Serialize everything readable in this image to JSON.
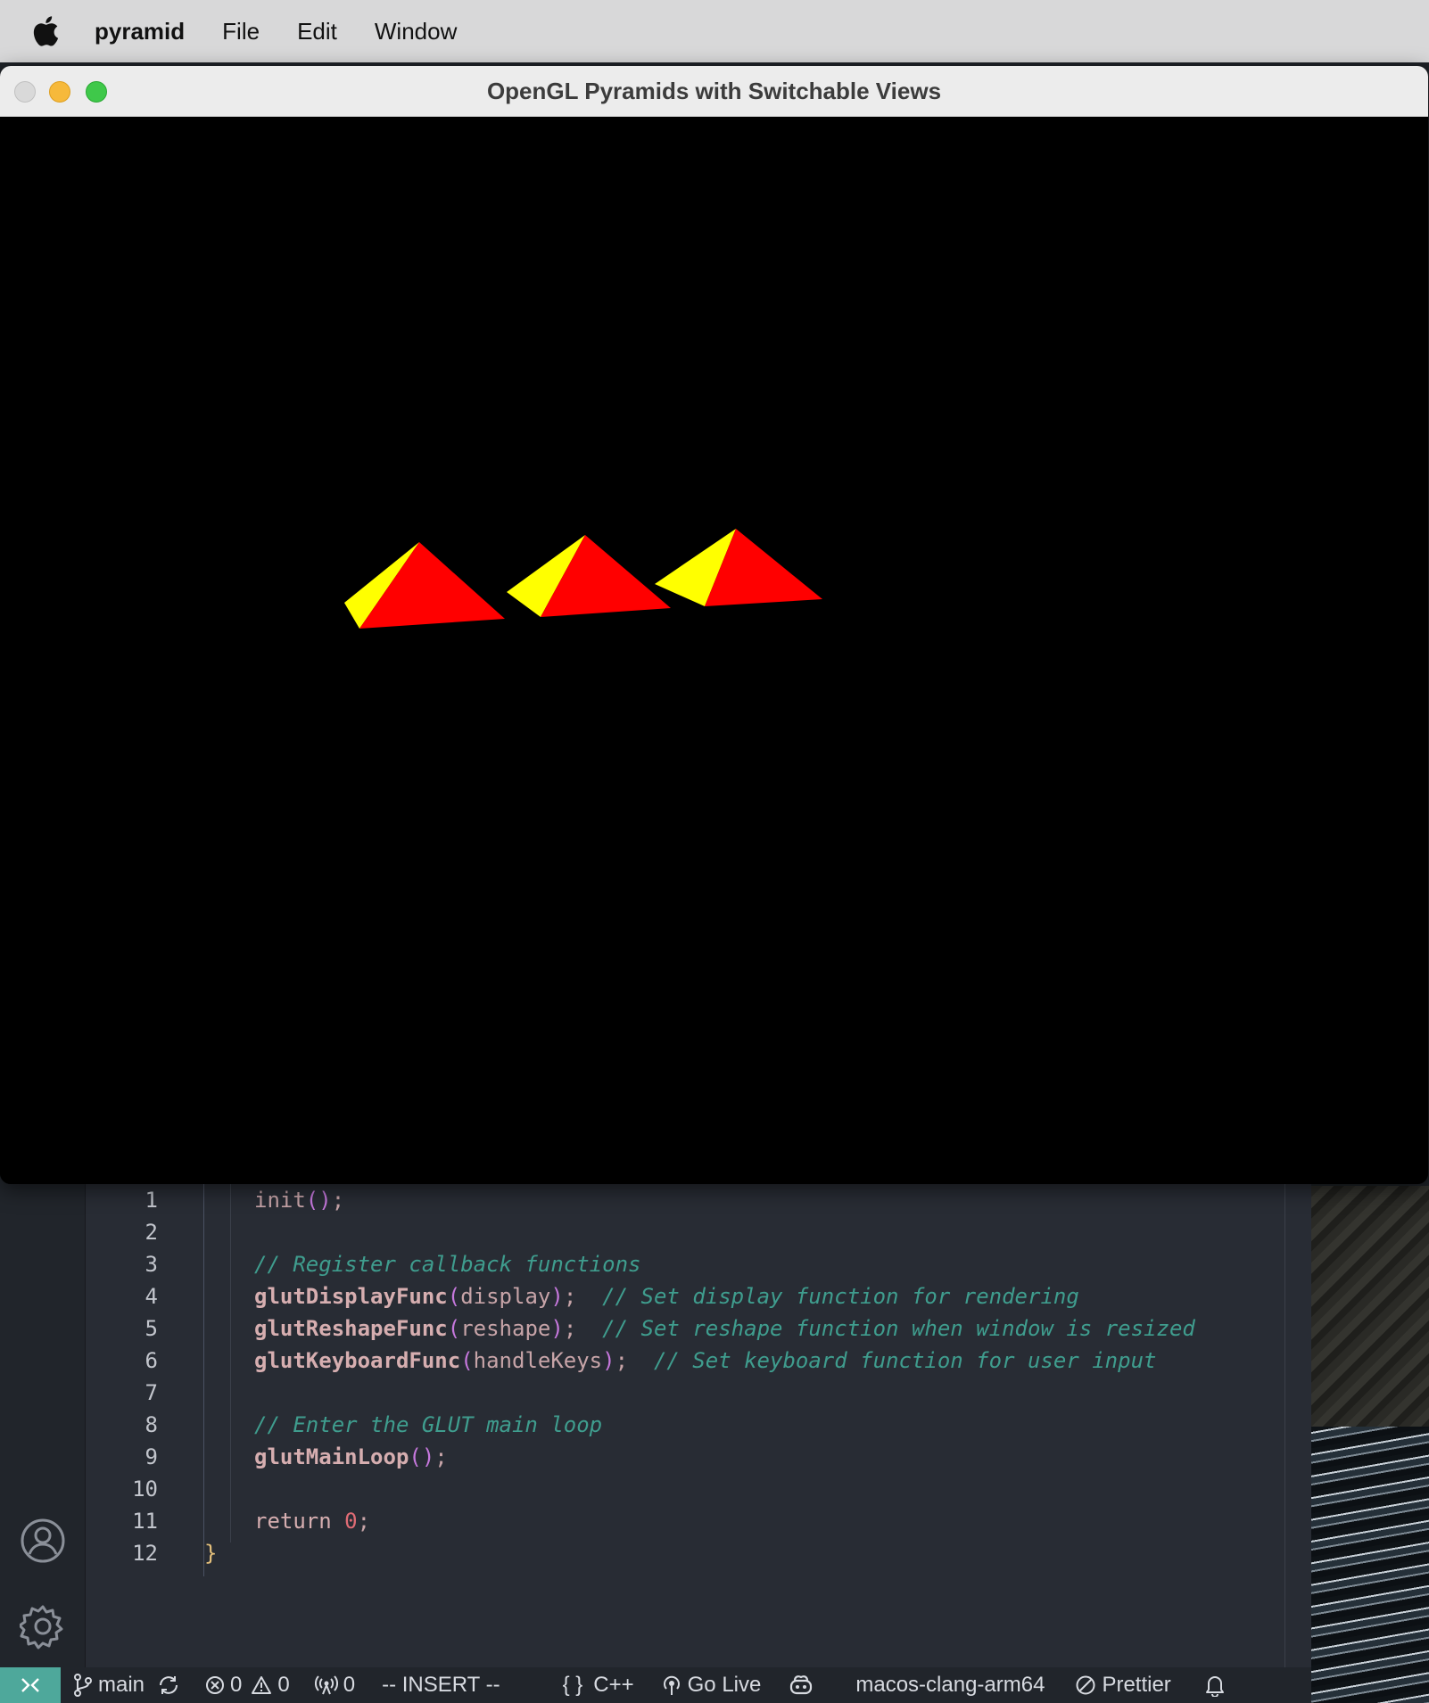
{
  "menubar": {
    "app_name": "pyramid",
    "items": [
      "File",
      "Edit",
      "Window"
    ]
  },
  "gl_window": {
    "title": "OpenGL Pyramids with Switchable Views",
    "colors": {
      "face_front": "#ff0000",
      "face_side": "#ffff00",
      "background": "#000000"
    },
    "pyramid_count": 3
  },
  "editor": {
    "lines": [
      {
        "n": "1",
        "tokens": [
          [
            "plain",
            "init"
          ],
          [
            "paren",
            "()"
          ],
          [
            "punct",
            ";"
          ]
        ]
      },
      {
        "n": "2",
        "tokens": []
      },
      {
        "n": "3",
        "tokens": [
          [
            "comment",
            "// Register callback functions"
          ]
        ]
      },
      {
        "n": "4",
        "tokens": [
          [
            "fn",
            "glutDisplayFunc"
          ],
          [
            "paren",
            "("
          ],
          [
            "plain",
            "display"
          ],
          [
            "paren",
            ")"
          ],
          [
            "punct",
            ";  "
          ],
          [
            "comment",
            "// Set display function for rendering"
          ]
        ]
      },
      {
        "n": "5",
        "tokens": [
          [
            "fn",
            "glutReshapeFunc"
          ],
          [
            "paren",
            "("
          ],
          [
            "plain",
            "reshape"
          ],
          [
            "paren",
            ")"
          ],
          [
            "punct",
            ";  "
          ],
          [
            "comment",
            "// Set reshape function when window is resized"
          ]
        ]
      },
      {
        "n": "6",
        "tokens": [
          [
            "fn",
            "glutKeyboardFunc"
          ],
          [
            "paren",
            "("
          ],
          [
            "plain",
            "handleKeys"
          ],
          [
            "paren",
            ")"
          ],
          [
            "punct",
            ";  "
          ],
          [
            "comment",
            "// Set keyboard function for user input"
          ]
        ]
      },
      {
        "n": "7",
        "tokens": []
      },
      {
        "n": "8",
        "tokens": [
          [
            "comment",
            "// Enter the GLUT main loop"
          ]
        ]
      },
      {
        "n": "9",
        "tokens": [
          [
            "fn",
            "glutMainLoop"
          ],
          [
            "paren",
            "()"
          ],
          [
            "punct",
            ";"
          ]
        ]
      },
      {
        "n": "10",
        "tokens": []
      },
      {
        "n": "11",
        "tokens": [
          [
            "kw",
            "return "
          ],
          [
            "num",
            "0"
          ],
          [
            "punct",
            ";"
          ]
        ]
      },
      {
        "n": "12",
        "tokens": [
          [
            "brace",
            "}"
          ]
        ]
      }
    ]
  },
  "statusbar": {
    "branch": "main",
    "errors": "0",
    "warnings": "0",
    "ports": "0",
    "mode": "-- INSERT --",
    "language": "C++",
    "go_live": "Go Live",
    "config": "macos-clang-arm64",
    "formatter": "Prettier"
  }
}
